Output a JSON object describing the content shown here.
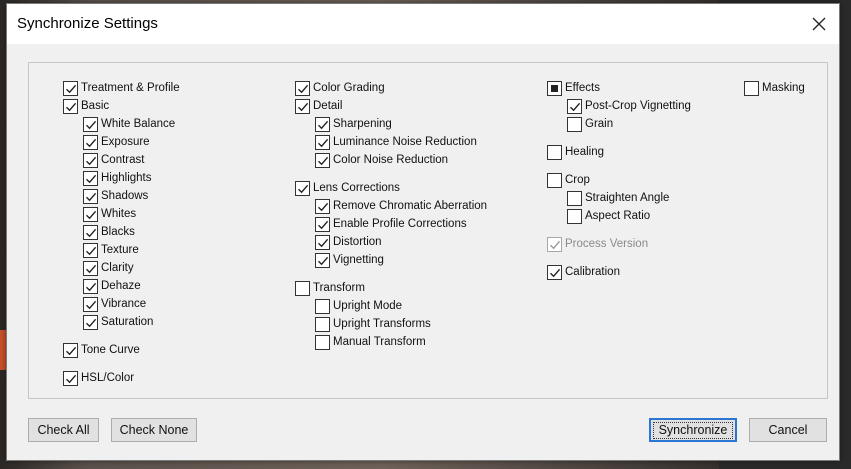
{
  "dialog": {
    "title": "Synchronize Settings",
    "close_label": "✕"
  },
  "options": [
    {
      "label": "Treatment & Profile",
      "state": "checked"
    },
    {
      "label": "Basic",
      "state": "checked"
    },
    {
      "label": "White Balance",
      "state": "checked"
    },
    {
      "label": "Exposure",
      "state": "checked"
    },
    {
      "label": "Contrast",
      "state": "checked"
    },
    {
      "label": "Highlights",
      "state": "checked"
    },
    {
      "label": "Shadows",
      "state": "checked"
    },
    {
      "label": "Whites",
      "state": "checked"
    },
    {
      "label": "Blacks",
      "state": "checked"
    },
    {
      "label": "Texture",
      "state": "checked"
    },
    {
      "label": "Clarity",
      "state": "checked"
    },
    {
      "label": "Dehaze",
      "state": "checked"
    },
    {
      "label": "Vibrance",
      "state": "checked"
    },
    {
      "label": "Saturation",
      "state": "checked"
    },
    {
      "label": "Tone Curve",
      "state": "checked"
    },
    {
      "label": "HSL/Color",
      "state": "checked"
    },
    {
      "label": "Color Grading",
      "state": "checked"
    },
    {
      "label": "Detail",
      "state": "checked"
    },
    {
      "label": "Sharpening",
      "state": "checked"
    },
    {
      "label": "Luminance Noise Reduction",
      "state": "checked"
    },
    {
      "label": "Color Noise Reduction",
      "state": "checked"
    },
    {
      "label": "Lens Corrections",
      "state": "checked"
    },
    {
      "label": "Remove Chromatic Aberration",
      "state": "checked"
    },
    {
      "label": "Enable Profile Corrections",
      "state": "checked"
    },
    {
      "label": "Distortion",
      "state": "checked"
    },
    {
      "label": "Vignetting",
      "state": "checked"
    },
    {
      "label": "Transform",
      "state": "unchecked"
    },
    {
      "label": "Upright Mode",
      "state": "unchecked"
    },
    {
      "label": "Upright Transforms",
      "state": "unchecked"
    },
    {
      "label": "Manual Transform",
      "state": "unchecked"
    },
    {
      "label": "Effects",
      "state": "mixed"
    },
    {
      "label": "Post-Crop Vignetting",
      "state": "checked"
    },
    {
      "label": "Grain",
      "state": "unchecked"
    },
    {
      "label": "Healing",
      "state": "unchecked"
    },
    {
      "label": "Crop",
      "state": "unchecked"
    },
    {
      "label": "Straighten Angle",
      "state": "unchecked"
    },
    {
      "label": "Aspect Ratio",
      "state": "unchecked"
    },
    {
      "label": "Process Version",
      "state": "checked-disabled"
    },
    {
      "label": "Calibration",
      "state": "checked"
    },
    {
      "label": "Masking",
      "state": "unchecked"
    }
  ],
  "buttons": {
    "check_all": "Check All",
    "check_none": "Check None",
    "synchronize": "Synchronize",
    "cancel": "Cancel"
  },
  "colors": {
    "dialog_bg": "#f0f0f0",
    "default_button_border": "#2a76d2",
    "disabled_text": "#8a8a8a"
  }
}
